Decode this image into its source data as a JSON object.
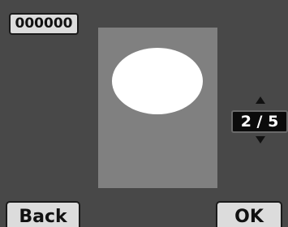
{
  "counter": {
    "value": "000000"
  },
  "navigation": {
    "page_indicator": "2 / 5",
    "up_icon": "triangle-up-icon",
    "down_icon": "triangle-down-icon"
  },
  "buttons": {
    "back_label": "Back",
    "ok_label": "OK"
  },
  "colors": {
    "background": "#484848",
    "preview_panel": "#808080",
    "preview_shape": "#ffffff",
    "button_face": "#dcdcdc",
    "indicator_bg": "#0b0b0b"
  }
}
